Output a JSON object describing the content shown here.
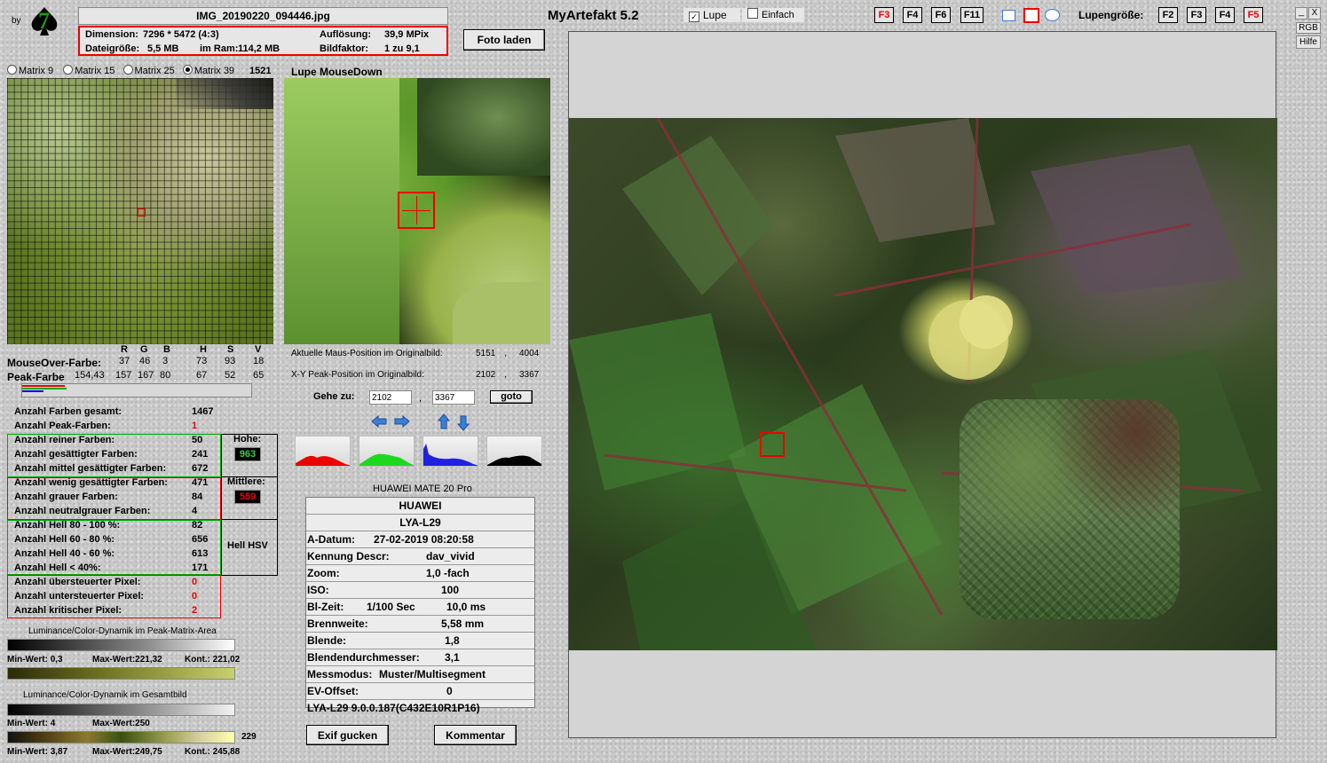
{
  "app": {
    "title": "MyArtefakt 5.2",
    "by": "by",
    "logo_number": "7"
  },
  "file": {
    "name": "IMG_20190220_094446.jpg",
    "dimension_label": "Dimension:",
    "dimension_value": "7296 * 5472 (4:3)",
    "resolution_label": "Auflösung:",
    "resolution_value": "39,9 MPix",
    "filesize_label": "Dateigröße:",
    "filesize_value": "5,5 MB",
    "ram_label": "im Ram:",
    "ram_value": "114,2 MB",
    "factor_label": "Bildfaktor:",
    "factor_value": "1 zu 9,1"
  },
  "buttons": {
    "load": "Foto laden",
    "goto": "goto",
    "exif": "Exif gucken",
    "comment": "Kommentar"
  },
  "toolbar": {
    "lupe": "Lupe",
    "einfach": "Einfach",
    "lupe_checked": true,
    "fkeys": [
      {
        "label": "F3",
        "red": true
      },
      {
        "label": "F4",
        "red": false
      },
      {
        "label": "F6",
        "red": false
      },
      {
        "label": "F11",
        "red": false
      }
    ],
    "lupe_size_label": "Lupengröße:",
    "size_keys": [
      {
        "label": "F2",
        "red": false
      },
      {
        "label": "F3",
        "red": false
      },
      {
        "label": "F4",
        "red": false
      },
      {
        "label": "F5",
        "red": true
      }
    ],
    "win_min": "_",
    "win_close": "X",
    "rgb": "RGB",
    "help": "Hilfe"
  },
  "matrix": {
    "options": [
      "Matrix 9",
      "Matrix 15",
      "Matrix 25",
      "Matrix 39"
    ],
    "selected": 3,
    "count": "1521"
  },
  "lupe_title": "Lupe MouseDown",
  "colors": {
    "headers": [
      "R",
      "G",
      "B",
      "H",
      "S",
      "V"
    ],
    "mouseover_label": "MouseOver-Farbe:",
    "mouseover": [
      "37",
      "46",
      "3",
      "73",
      "93",
      "18"
    ],
    "peak_label": "Peak-Farbe",
    "peak_extra": "154,43",
    "peak": [
      "157",
      "167",
      "80",
      "67",
      "52",
      "65"
    ]
  },
  "position": {
    "mouse_label": "Aktuelle Maus-Position  im Originalbild:",
    "mouse_x": "5151",
    "mouse_y": "4004",
    "peak_label": "X-Y Peak-Position  im Originalbild:",
    "peak_x": "2102",
    "peak_y": "3367",
    "goto_label": "Gehe zu:",
    "goto_x": "2102",
    "goto_y": "3367",
    "sep": ","
  },
  "stats": [
    {
      "label": "Anzahl Farben gesamt:",
      "value": "1467",
      "red": false
    },
    {
      "label": "Anzahl Peak-Farben:",
      "value": "1",
      "red": true
    },
    {
      "label": "Anzahl reiner Farben:",
      "value": "50",
      "red": false
    },
    {
      "label": "Anzahl gesättigter Farben:",
      "value": "241",
      "red": false
    },
    {
      "label": "Anzahl mittel gesättigter Farben:",
      "value": "672",
      "red": false
    },
    {
      "label": "Anzahl wenig gesättigter Farben:",
      "value": "471",
      "red": false
    },
    {
      "label": "Anzahl grauer Farben:",
      "value": "84",
      "red": false
    },
    {
      "label": "Anzahl neutralgrauer Farben:",
      "value": "4",
      "red": false
    },
    {
      "label": "Anzahl Hell 80 - 100 %:",
      "value": "82",
      "red": false
    },
    {
      "label": "Anzahl Hell 60 - 80 %:",
      "value": "656",
      "red": false
    },
    {
      "label": "Anzahl Hell 40 - 60 %:",
      "value": "613",
      "red": false
    },
    {
      "label": "Anzahl Hell < 40%:",
      "value": "171",
      "red": false
    },
    {
      "label": "Anzahl übersteuerter Pixel:",
      "value": "0",
      "red": true
    },
    {
      "label": "Anzahl untersteuerter Pixel:",
      "value": "0",
      "red": true
    },
    {
      "label": "Anzahl kritischer Pixel:",
      "value": "2",
      "red": true
    }
  ],
  "side": {
    "hohe_label": "Hohe:",
    "hohe_value": "963",
    "mittlere_label": "Mittlere:",
    "mittlere_value": "559",
    "hsv_label": "Hell HSV"
  },
  "dynamics": {
    "peak_title": "Luminance/Color-Dynamik im Peak-Matrix-Area",
    "peak_min": "Min-Wert: 0,3",
    "peak_max": "Max-Wert:221,32",
    "peak_kont": "Kont.: 221,02",
    "total_title": "Luminance/Color-Dynamik im Gesamtbild",
    "total_min": "Min-Wert: 4",
    "total_max": "Max-Wert:250",
    "total2_min": "Min-Wert: 3,87",
    "total2_max": "Max-Wert:249,75",
    "total2_kont": "Kont.: 245,88",
    "total2_end": "229"
  },
  "exif": {
    "model": "HUAWEI MATE 20 Pro",
    "rows": [
      {
        "k": "",
        "v": "HUAWEI"
      },
      {
        "k": "",
        "v": "LYA-L29"
      },
      {
        "k": "A-Datum:",
        "v": "27-02-2019 08:20:58"
      },
      {
        "k": "Kennung Descr:",
        "v": "dav_vivid"
      },
      {
        "k": "Zoom:",
        "v": "1,0 -fach"
      },
      {
        "k": "ISO:",
        "v": "100"
      },
      {
        "k": "Bl-Zeit:",
        "v": "1/100 Sec",
        "v2": "10,0 ms"
      },
      {
        "k": "Brennweite:",
        "v": "5,58  mm"
      },
      {
        "k": "Blende:",
        "v": "1,8"
      },
      {
        "k": "Blendendurchmesser:",
        "v": "3,1"
      },
      {
        "k": "Messmodus:",
        "v": "Muster/Multisegment"
      },
      {
        "k": "EV-Offset:",
        "v": "0"
      },
      {
        "k": "",
        "v": "LYA-L29 9.0.0.187(C432E10R1P16)"
      }
    ]
  }
}
